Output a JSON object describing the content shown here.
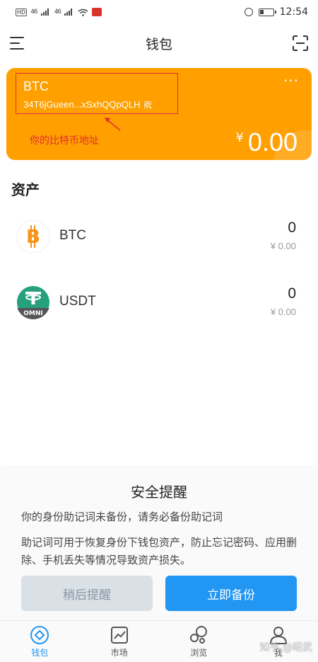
{
  "status_bar": {
    "hd_label": "HD",
    "signal_1": "46",
    "signal_2": "46",
    "time": "12:54"
  },
  "nav": {
    "title": "钱包"
  },
  "wallet_card": {
    "coin": "BTC",
    "address": "34T6jGueen...xSxhQQpQLH",
    "currency_symbol": "¥",
    "balance": "0.00",
    "more_glyph": "···",
    "color": "#ff9f00"
  },
  "annotation": {
    "text": "你的比特币地址",
    "color": "#e03030"
  },
  "assets": {
    "title": "资产",
    "items": [
      {
        "name": "BTC",
        "quantity": "0",
        "fiat": "¥ 0.00",
        "icon": "bitcoin-icon"
      },
      {
        "name": "USDT",
        "quantity": "0",
        "fiat": "¥ 0.00",
        "icon": "tether-omni-icon",
        "icon_badge": "OMNI"
      }
    ]
  },
  "security_sheet": {
    "title": "安全提醒",
    "line1": "你的身份助记词未备份，请务必备份助记词",
    "line2": "助记词可用于恢复身份下钱包资产，防止忘记密码、应用删除、手机丢失等情况导致资产损失。",
    "later_label": "稍后提醒",
    "backup_label": "立即备份",
    "primary_color": "#2196f3"
  },
  "tabs": [
    {
      "label": "钱包",
      "icon": "wallet-icon",
      "active": true
    },
    {
      "label": "市场",
      "icon": "market-chart-icon",
      "active": false
    },
    {
      "label": "浏览",
      "icon": "browse-bubbles-icon",
      "active": false
    },
    {
      "label": "我",
      "icon": "profile-icon",
      "active": false
    }
  ],
  "watermark": "知乎 @昭武"
}
